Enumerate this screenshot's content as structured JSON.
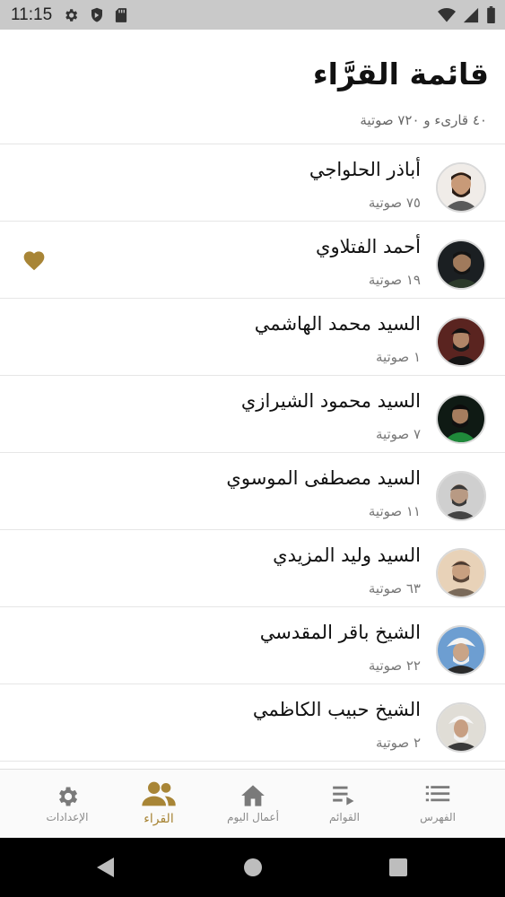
{
  "status_bar": {
    "time": "11:15",
    "left_icons": [
      "gear-icon",
      "shield-icon",
      "sd-card-icon"
    ],
    "right_icons": [
      "wifi-icon",
      "signal-icon",
      "battery-icon"
    ]
  },
  "header": {
    "title": "قائمة القرَّاء",
    "subtitle": "٤٠ قارىء و ٧٢٠ صوتية"
  },
  "colors": {
    "accent": "#a88536",
    "text": "#111111",
    "muted": "#777777"
  },
  "readers": [
    {
      "name": "أباذر الحلواجي",
      "count": "٧٥ صوتية",
      "favorite": false
    },
    {
      "name": "أحمد الفتلاوي",
      "count": "١٩ صوتية",
      "favorite": true
    },
    {
      "name": "السيد محمد الهاشمي",
      "count": "١ صوتية",
      "favorite": false
    },
    {
      "name": "السيد محمود الشيرازي",
      "count": "٧ صوتية",
      "favorite": false
    },
    {
      "name": "السيد مصطفى الموسوي",
      "count": "١١ صوتية",
      "favorite": false
    },
    {
      "name": "السيد وليد المزيدي",
      "count": "٦٣ صوتية",
      "favorite": false
    },
    {
      "name": "الشيخ باقر المقدسي",
      "count": "٢٢ صوتية",
      "favorite": false
    },
    {
      "name": "الشيخ حبيب الكاظمي",
      "count": "٢ صوتية",
      "favorite": false
    }
  ],
  "bottom_nav": {
    "active": "readers",
    "items": [
      {
        "id": "settings",
        "label": "الإعدادات",
        "icon": "gear-icon"
      },
      {
        "id": "readers",
        "label": "القراء",
        "icon": "people-icon"
      },
      {
        "id": "today",
        "label": "أعمال اليوم",
        "icon": "home-icon"
      },
      {
        "id": "lists",
        "label": "القوائم",
        "icon": "playlist-icon"
      },
      {
        "id": "index",
        "label": "الفهرس",
        "icon": "list-icon"
      }
    ]
  },
  "android_nav": [
    "back-icon",
    "home-circle-icon",
    "recents-icon"
  ]
}
